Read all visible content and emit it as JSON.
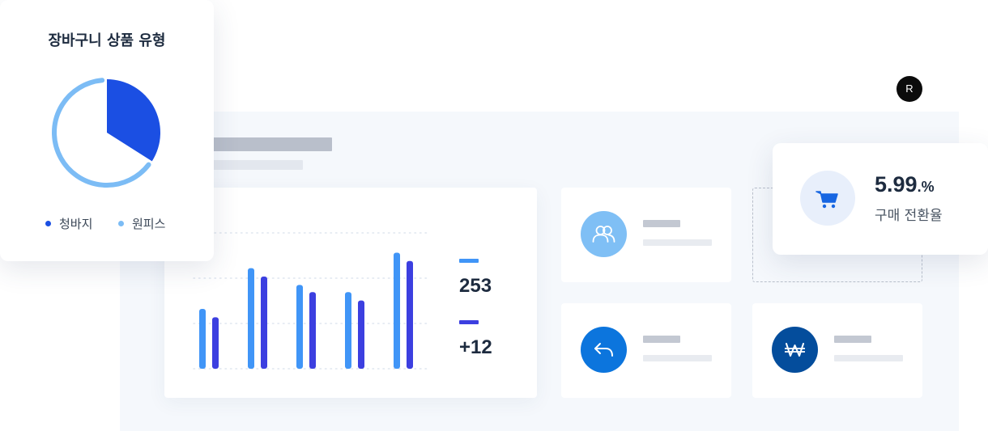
{
  "header": {
    "avatar_initial": "R"
  },
  "pie_card": {
    "title": "장바구니 상품 유형",
    "legend": [
      {
        "label": "청바지",
        "color": "#1b4fe3"
      },
      {
        "label": "원피스",
        "color": "#7cbcf5"
      }
    ],
    "share_percent": 34
  },
  "chart_card": {
    "bar_colors": [
      "#4095f7",
      "#3c3fe0"
    ],
    "bar_levels": [
      [
        0.5,
        0.43
      ],
      [
        0.84,
        0.77
      ],
      [
        0.7,
        0.64
      ],
      [
        0.64,
        0.57
      ],
      [
        0.97,
        0.9
      ]
    ],
    "stats": [
      {
        "value": "253",
        "color": "#4095f7"
      },
      {
        "value": "+12",
        "color": "#3c3fe0"
      }
    ]
  },
  "mini_cards": [
    {
      "icon": "users-icon",
      "color": "#7fbff5"
    },
    {
      "icon": "reply-arrow-icon",
      "color": "#0c75dd"
    },
    {
      "icon": "won-icon",
      "color": "#044d9c"
    }
  ],
  "conversion_card": {
    "value": "5.99",
    "unit": ".%",
    "label": "구매 전환율",
    "icon": "cart-icon",
    "icon_color": "#1766e2"
  }
}
